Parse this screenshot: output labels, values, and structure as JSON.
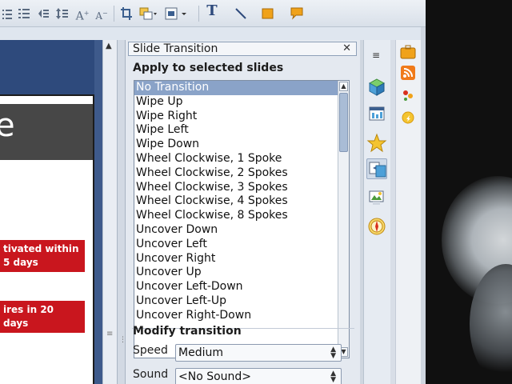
{
  "toolbar": {
    "buttons": [
      {
        "name": "bullets-list-icon"
      },
      {
        "name": "numbered-list-icon"
      },
      {
        "name": "paragraph-move-icon"
      },
      {
        "name": "line-spacing-icon"
      },
      {
        "name": "increase-font-icon",
        "glyph": "A"
      },
      {
        "name": "decrease-font-icon",
        "glyph": "A"
      },
      {
        "name": "crop-icon"
      },
      {
        "name": "arrange-icon"
      },
      {
        "name": "align-icon"
      },
      {
        "name": "text-tool-icon",
        "glyph": "T"
      },
      {
        "name": "line-tool-icon"
      },
      {
        "name": "rectangle-tool-icon"
      },
      {
        "name": "callout-tool-icon"
      }
    ]
  },
  "slide": {
    "title_fragment": "e",
    "note1": "tivated within 5 days",
    "note2": "ires in 20 days",
    "accent_red": "#c9161e",
    "header_gray": "#474747"
  },
  "pane": {
    "title": "Slide Transition",
    "close_glyph": "✕",
    "apply_label": "Apply to selected slides",
    "transitions": [
      "No Transition",
      "Wipe Up",
      "Wipe Right",
      "Wipe Left",
      "Wipe Down",
      "Wheel Clockwise, 1 Spoke",
      "Wheel Clockwise, 2 Spokes",
      "Wheel Clockwise, 3 Spokes",
      "Wheel Clockwise, 4 Spokes",
      "Wheel Clockwise, 8 Spokes",
      "Uncover Down",
      "Uncover Left",
      "Uncover Right",
      "Uncover Up",
      "Uncover Left-Down",
      "Uncover Left-Up",
      "Uncover Right-Down"
    ],
    "selected_index": 0,
    "modify_label": "Modify transition",
    "speed_label": "Speed",
    "speed_value": "Medium",
    "sound_label": "Sound",
    "sound_value": "<No Sound>"
  },
  "sidebar": {
    "menu_glyph": "≡",
    "tabs": [
      {
        "name": "master-pages-icon",
        "active": false
      },
      {
        "name": "layouts-icon",
        "active": false
      },
      {
        "name": "custom-animation-icon",
        "active": false
      },
      {
        "name": "slide-transition-icon",
        "active": true
      },
      {
        "name": "gallery-icon",
        "active": false
      },
      {
        "name": "navigator-icon",
        "active": false
      }
    ]
  },
  "sidebar2": {
    "tabs": [
      {
        "name": "briefcase-icon"
      },
      {
        "name": "rss-feed-icon"
      },
      {
        "name": "apps-icon"
      },
      {
        "name": "sun-icon"
      }
    ]
  },
  "colors": {
    "selection": "#8aa3c8",
    "slide_area": "#2e4a7c"
  }
}
